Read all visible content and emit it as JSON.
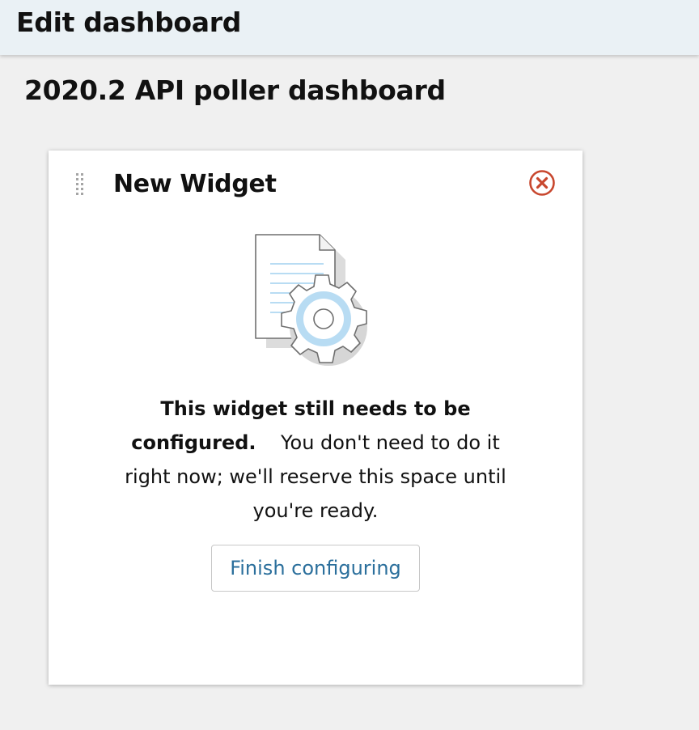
{
  "header": {
    "title": "Edit dashboard"
  },
  "dashboard": {
    "name": "2020.2 API poller dashboard"
  },
  "widget": {
    "title": "New Widget",
    "message_bold": "This widget still needs to be configured.",
    "message_rest": "You don't need to do it right now; we'll reserve this space until you're ready.",
    "finish_button_label": "Finish configuring"
  },
  "icons": {
    "drag_handle": "drag-handle-icon",
    "close": "close-circle-icon",
    "illustration": "document-gear-icon"
  },
  "colors": {
    "header_bg": "#eaf1f5",
    "page_bg": "#f0f0f0",
    "close_icon": "#c8472e",
    "link_text": "#2b6f9c",
    "illustration_accent": "#b8dcf3"
  }
}
